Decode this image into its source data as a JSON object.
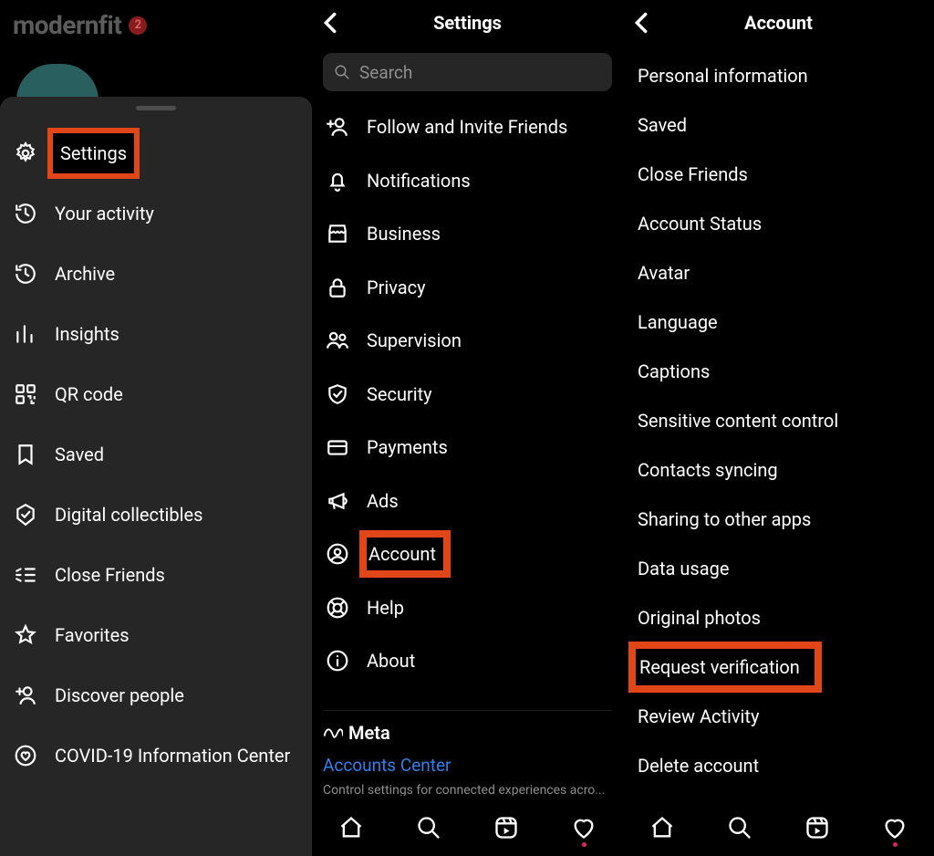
{
  "brand": {
    "name": "modernfit",
    "badge": "2"
  },
  "panel1": {
    "items": [
      {
        "label": "Settings"
      },
      {
        "label": "Your activity"
      },
      {
        "label": "Archive"
      },
      {
        "label": "Insights"
      },
      {
        "label": "QR code"
      },
      {
        "label": "Saved"
      },
      {
        "label": "Digital collectibles"
      },
      {
        "label": "Close Friends"
      },
      {
        "label": "Favorites"
      },
      {
        "label": "Discover people"
      },
      {
        "label": "COVID-19 Information Center"
      }
    ]
  },
  "panel2": {
    "title": "Settings",
    "search_placeholder": "Search",
    "items": [
      {
        "label": "Follow and Invite Friends"
      },
      {
        "label": "Notifications"
      },
      {
        "label": "Business"
      },
      {
        "label": "Privacy"
      },
      {
        "label": "Supervision"
      },
      {
        "label": "Security"
      },
      {
        "label": "Payments"
      },
      {
        "label": "Ads"
      },
      {
        "label": "Account"
      },
      {
        "label": "Help"
      },
      {
        "label": "About"
      }
    ],
    "meta_brand": "Meta",
    "accounts_center_label": "Accounts Center",
    "meta_desc": "Control settings for connected experiences acro..."
  },
  "panel3": {
    "title": "Account",
    "items": [
      {
        "label": "Personal information"
      },
      {
        "label": "Saved"
      },
      {
        "label": "Close Friends"
      },
      {
        "label": "Account Status"
      },
      {
        "label": "Avatar"
      },
      {
        "label": "Language"
      },
      {
        "label": "Captions"
      },
      {
        "label": "Sensitive content control"
      },
      {
        "label": "Contacts syncing"
      },
      {
        "label": "Sharing to other apps"
      },
      {
        "label": "Data usage"
      },
      {
        "label": "Original photos"
      },
      {
        "label": "Request verification"
      },
      {
        "label": "Review Activity"
      },
      {
        "label": "Delete account"
      }
    ]
  }
}
